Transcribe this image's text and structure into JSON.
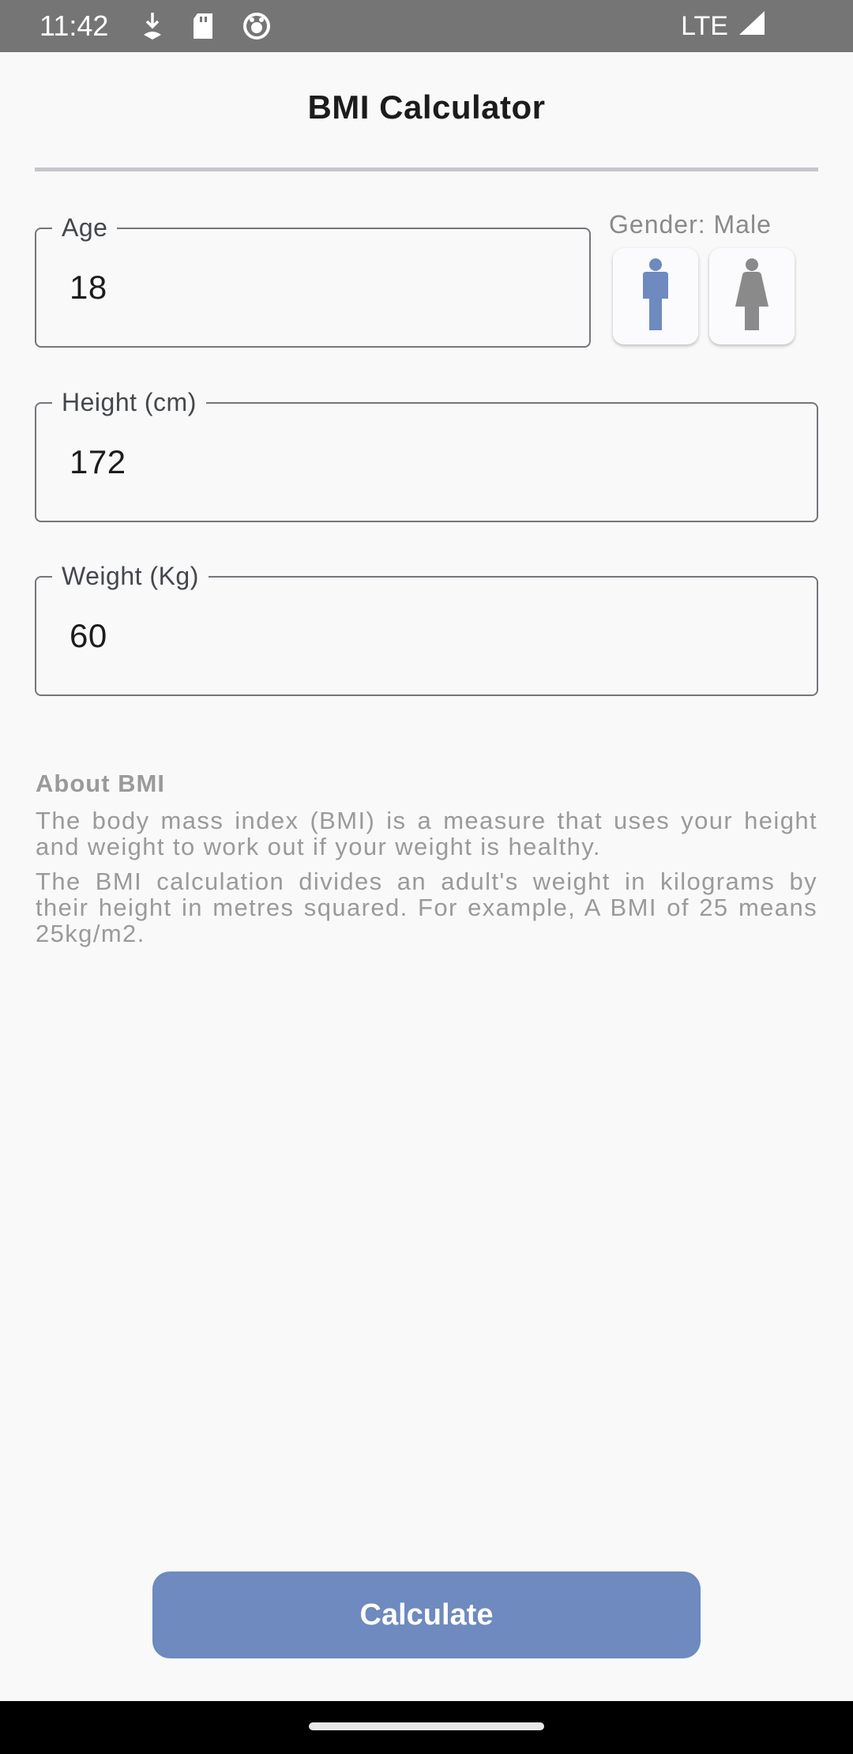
{
  "status_bar": {
    "time": "11:42",
    "network": "LTE",
    "icons": [
      "download-icon",
      "sd-card-icon",
      "app-icon",
      "signal-icon"
    ]
  },
  "header": {
    "title": "BMI Calculator"
  },
  "form": {
    "age": {
      "label": "Age",
      "value": "18"
    },
    "gender": {
      "label": "Gender: Male",
      "selected": "male"
    },
    "height": {
      "label": "Height (cm)",
      "value": "172"
    },
    "weight": {
      "label": "Weight (Kg)",
      "value": "60"
    }
  },
  "about": {
    "title": "About BMI",
    "para1": "The body mass index (BMI) is a measure that uses your height and weight to work out if your weight is healthy.",
    "para2": "The BMI calculation divides an adult's weight in kilograms by their height in metres squared. For example, A BMI of 25 means 25kg/m2."
  },
  "actions": {
    "calculate_label": "Calculate"
  },
  "colors": {
    "accent": "#6e8abe",
    "male_icon": "#6e8abe",
    "female_icon": "#8a8a8a",
    "status_bar": "#757575"
  }
}
